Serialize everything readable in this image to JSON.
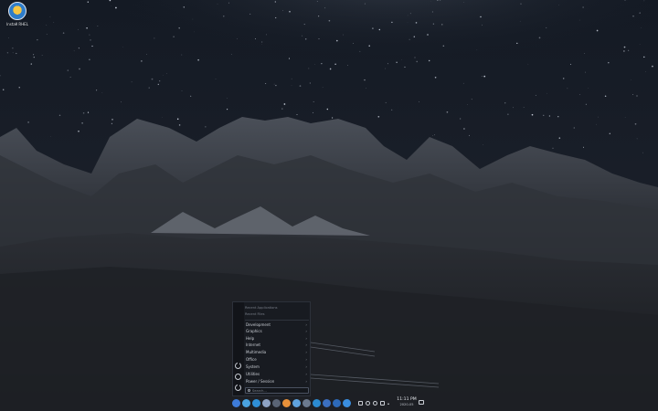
{
  "desktop": {
    "icons": [
      {
        "label": "Install RHEL",
        "icon": "installer-icon"
      }
    ]
  },
  "start_menu": {
    "recent": [
      "Recent Applications",
      "Recent Files"
    ],
    "categories": [
      "Development",
      "Graphics",
      "Help",
      "Internet",
      "Multimedia",
      "Office",
      "System",
      "Utilities",
      "Power / Session"
    ],
    "search_placeholder": "Search...",
    "side_icons": [
      "system-icon",
      "refresh-icon",
      "power-icon"
    ]
  },
  "taskbar": {
    "apps": [
      {
        "name": "start-menu-icon",
        "color": "#3d7bd9"
      },
      {
        "name": "file-manager-icon",
        "color": "#4aa3e0"
      },
      {
        "name": "discover-icon",
        "color": "#2f8fd6"
      },
      {
        "name": "settings-icon",
        "color": "#8ea3c4"
      },
      {
        "name": "terminal-icon",
        "color": "#5a6475"
      },
      {
        "name": "firefox-icon",
        "color": "#e8913a"
      },
      {
        "name": "kate-icon",
        "color": "#5fa3de"
      },
      {
        "name": "spectacle-icon",
        "color": "#6b7a8f"
      },
      {
        "name": "calculator-icon",
        "color": "#2b8ad0"
      },
      {
        "name": "system-monitor-icon",
        "color": "#3b6fc0"
      },
      {
        "name": "dolphin-icon",
        "color": "#2d6ab9"
      },
      {
        "name": "help-icon",
        "color": "#3a8ee0"
      }
    ],
    "clock": {
      "time": "11:11 PM",
      "date": "2020-05"
    }
  }
}
